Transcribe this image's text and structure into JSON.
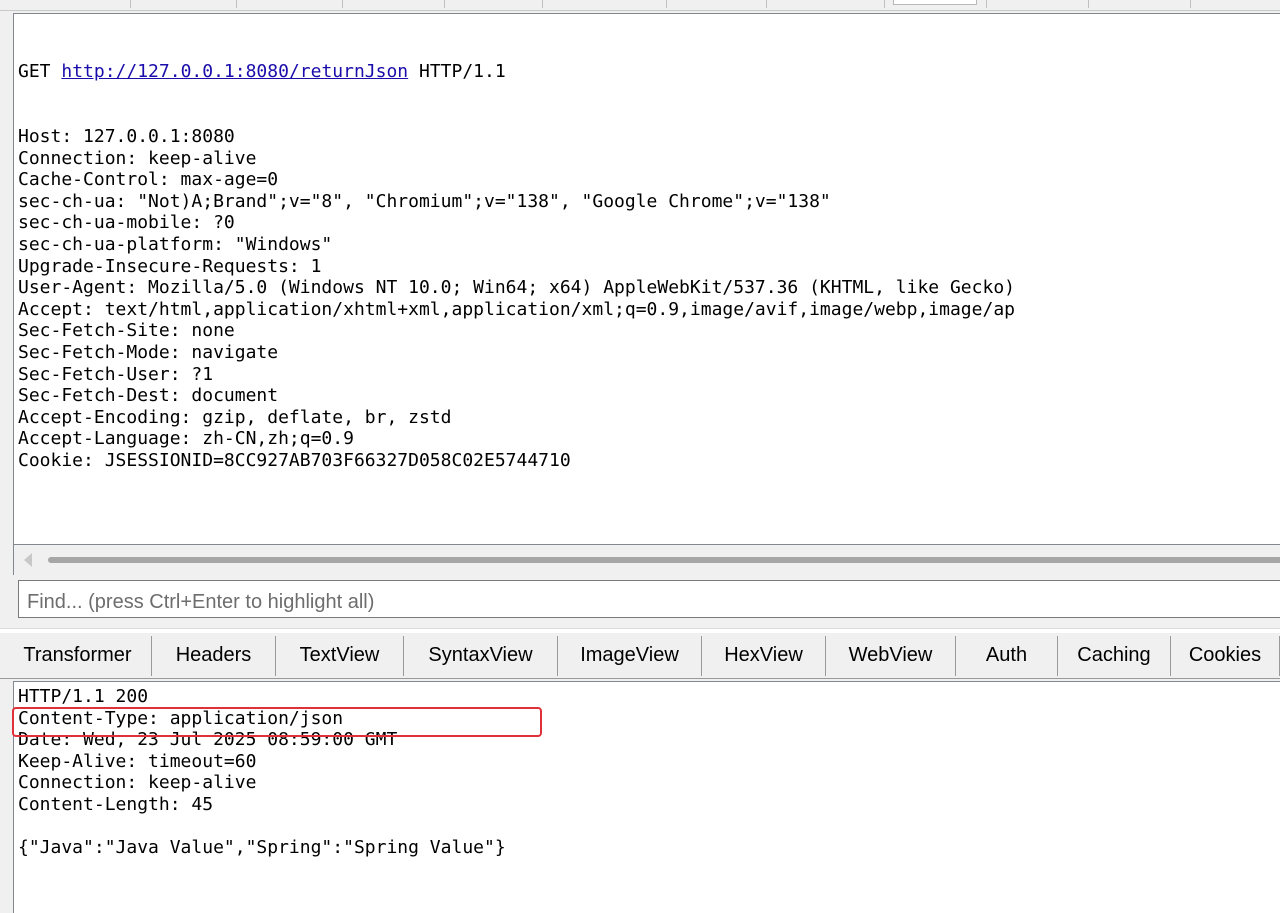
{
  "request": {
    "method": "GET",
    "url": "http://127.0.0.1:8080/returnJson",
    "protocol": "HTTP/1.1",
    "headers": [
      "Host: 127.0.0.1:8080",
      "Connection: keep-alive",
      "Cache-Control: max-age=0",
      "sec-ch-ua: \"Not)A;Brand\";v=\"8\", \"Chromium\";v=\"138\", \"Google Chrome\";v=\"138\"",
      "sec-ch-ua-mobile: ?0",
      "sec-ch-ua-platform: \"Windows\"",
      "Upgrade-Insecure-Requests: 1",
      "User-Agent: Mozilla/5.0 (Windows NT 10.0; Win64; x64) AppleWebKit/537.36 (KHTML, like Gecko)",
      "Accept: text/html,application/xhtml+xml,application/xml;q=0.9,image/avif,image/webp,image/ap",
      "Sec-Fetch-Site: none",
      "Sec-Fetch-Mode: navigate",
      "Sec-Fetch-User: ?1",
      "Sec-Fetch-Dest: document",
      "Accept-Encoding: gzip, deflate, br, zstd",
      "Accept-Language: zh-CN,zh;q=0.9",
      "Cookie: JSESSIONID=8CC927AB703F66327D058C02E5744710"
    ]
  },
  "find": {
    "placeholder": "Find... (press Ctrl+Enter to highlight all)"
  },
  "response_tabs": [
    "Transformer",
    "Headers",
    "TextView",
    "SyntaxView",
    "ImageView",
    "HexView",
    "WebView",
    "Auth",
    "Caching",
    "Cookies"
  ],
  "response": {
    "lines": [
      "HTTP/1.1 200",
      "Content-Type: application/json",
      "Date: Wed, 23 Jul 2025 08:59:00 GMT",
      "Keep-Alive: timeout=60",
      "Connection: keep-alive",
      "Content-Length: 45",
      "",
      "{\"Java\":\"Java Value\",\"Spring\":\"Spring Value\"}"
    ]
  },
  "colors": {
    "highlight_border": "#e0303a",
    "link": "#1a0dab"
  }
}
